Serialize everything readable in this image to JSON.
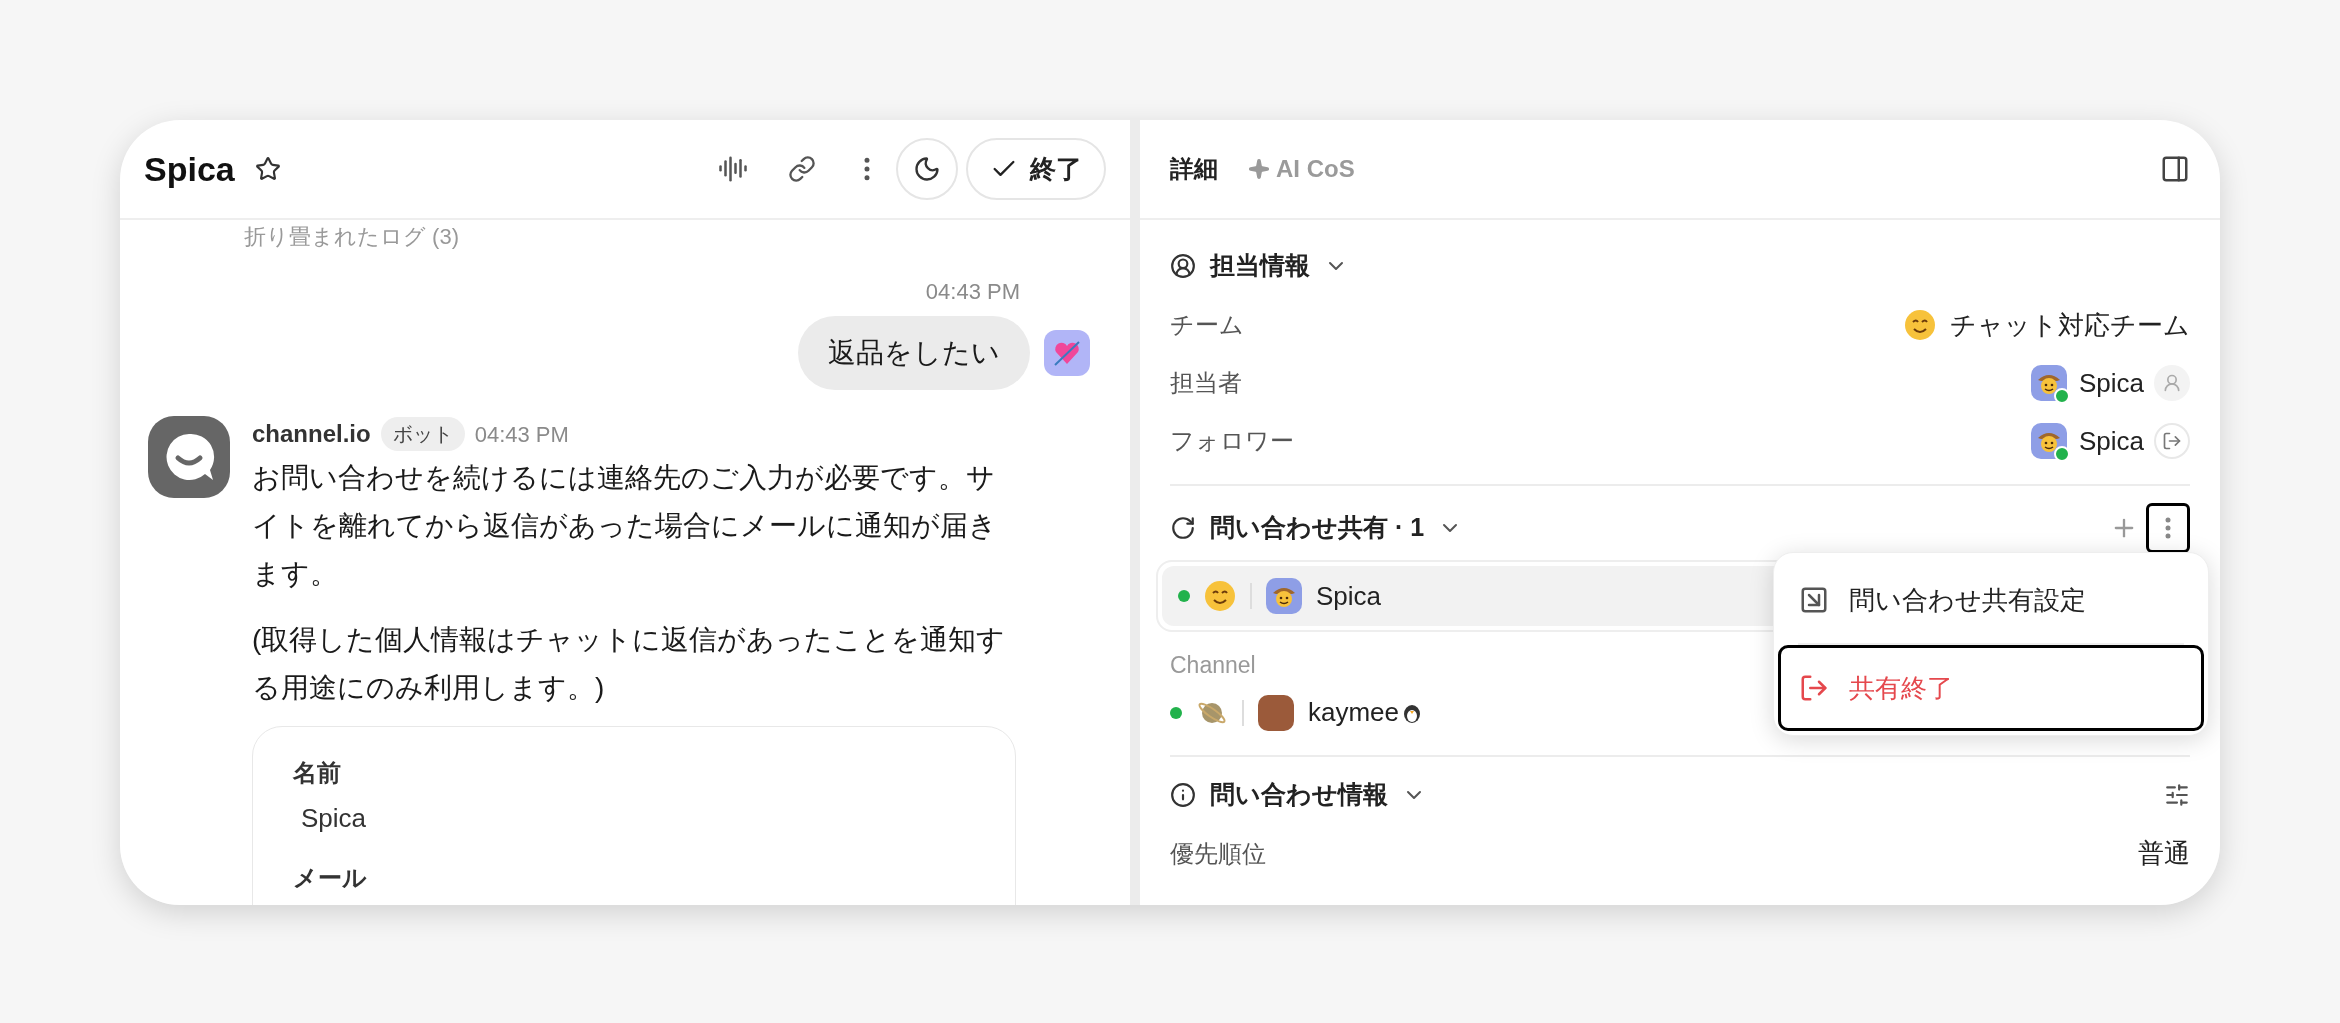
{
  "chat": {
    "title": "Spica",
    "finish_button": "終了",
    "collapsed_log": "折り畳まれたログ (3)",
    "messages": [
      {
        "kind": "user",
        "time": "04:43 PM",
        "text": "返品をしたい"
      },
      {
        "kind": "bot",
        "sender": "channel.io",
        "badge": "ボット",
        "time": "04:43 PM",
        "paragraphs": [
          "お問い合わせを続けるには連絡先のご入力が必要です。サイトを離れてから返信があった場合にメールに通知が届きます。",
          "(取得した個人情報はチャットに返信があったことを通知する用途にのみ利用します。)"
        ],
        "form": [
          {
            "label": "名前",
            "value": "Spica"
          },
          {
            "label": "メール"
          }
        ]
      }
    ]
  },
  "details": {
    "tabs": [
      {
        "kind": "plain",
        "label": "詳細",
        "selected": true
      },
      {
        "kind": "ai",
        "label": "AI CoS",
        "selected": false
      }
    ],
    "assignee_section": {
      "title": "担当情報",
      "rows": [
        {
          "kind": "team",
          "label": "チーム",
          "value": "チャット対応チーム"
        },
        {
          "kind": "assignee",
          "label": "担当者",
          "value": "Spica",
          "online": true
        },
        {
          "kind": "follower",
          "label": "フォロワー",
          "value": "Spica",
          "online": true
        }
      ]
    },
    "share_section": {
      "title": "問い合わせ共有 · 1",
      "more_focused": true,
      "shares": [
        {
          "name": "Spica",
          "online": true
        }
      ],
      "group_label": "Channel",
      "channel_shares": [
        {
          "name": "kaymee",
          "online": true
        }
      ]
    },
    "menu": {
      "items": [
        {
          "kind": "settings",
          "label": "問い合わせ共有設定",
          "highlighted": false
        },
        {
          "kind": "end",
          "label": "共有終了",
          "highlighted": true
        }
      ]
    },
    "info_section": {
      "title": "問い合わせ情報",
      "rows": [
        {
          "label": "優先順位",
          "value": "普通"
        }
      ]
    }
  }
}
